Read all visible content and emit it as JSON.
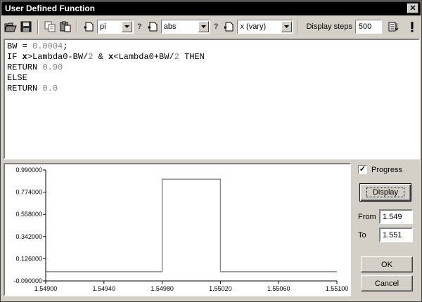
{
  "window": {
    "title": "User Defined Function"
  },
  "toolbar": {
    "combo_constant": "pi",
    "combo_function": "abs",
    "combo_variable": "x  (vary)",
    "help_mark": "?",
    "steps_label": "Display steps",
    "steps_value": "500"
  },
  "editor": {
    "line1_a": "BW = ",
    "line1_b": "0.0004",
    "line1_c": ";",
    "line2_a": "IF ",
    "line2_x1": "x",
    "line2_b": ">Lambda0-BW/",
    "line2_n1": "2",
    "line2_c": " & ",
    "line2_x2": "x",
    "line2_d": "<Lambda0+BW/",
    "line2_n2": "2",
    "line2_e": " THEN",
    "line3_a": "RETURN ",
    "line3_b": "0.90",
    "line4": "ELSE",
    "line5_a": "RETURN ",
    "line5_b": "0.0"
  },
  "side": {
    "progress_label": "Progress",
    "progress_checked": true,
    "display_label": "Display",
    "from_label": "From",
    "from_value": "1.549",
    "to_label": "To",
    "to_value": "1.551",
    "ok_label": "OK",
    "cancel_label": "Cancel"
  },
  "chart_data": {
    "type": "line",
    "x": [
      1.549,
      1.5498,
      1.5498,
      1.5502,
      1.5502,
      1.551
    ],
    "y": [
      0.0,
      0.0,
      0.9,
      0.9,
      0.0,
      0.0
    ],
    "xlim": [
      1.549,
      1.551
    ],
    "ylim": [
      -0.09,
      0.99
    ],
    "xticks": [
      "1.54900",
      "1.54940",
      "1.54980",
      "1.55020",
      "1.55060",
      "1.55100"
    ],
    "yticks": [
      "0.990000",
      "0.774000",
      "0.558000",
      "0.342000",
      "0.126000",
      "-0.090000"
    ],
    "line_color": "#8c8c8c",
    "grid": false
  }
}
